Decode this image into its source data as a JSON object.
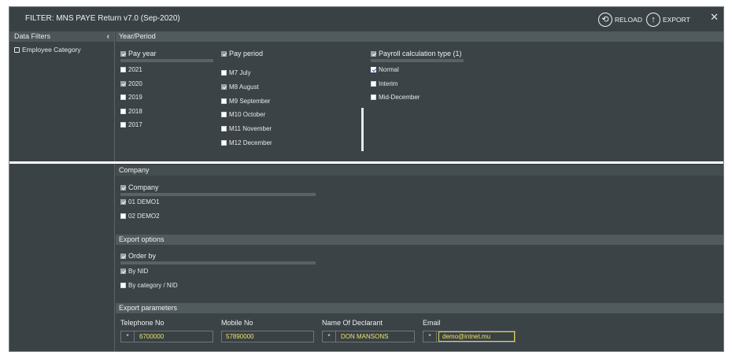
{
  "window": {
    "title": "FILTER: MNS PAYE Return v7.0 (Sep-2020)",
    "reload_label": "RELOAD",
    "export_label": "EXPORT",
    "close_symbol": "✕"
  },
  "left_panel": {
    "header": "Data Filters",
    "collapse_symbol": "‹",
    "items": [
      {
        "label": "Employee Category"
      }
    ]
  },
  "year_period": {
    "section_title": "Year/Period",
    "pay_year": {
      "title": "Pay year",
      "options": [
        {
          "label": "2021",
          "checked": false
        },
        {
          "label": "2020",
          "checked": true
        },
        {
          "label": "2019",
          "checked": false
        },
        {
          "label": "2018",
          "checked": false
        },
        {
          "label": "2017",
          "checked": false
        }
      ]
    },
    "pay_period": {
      "title": "Pay period",
      "options": [
        {
          "label": "M7 July",
          "checked": false
        },
        {
          "label": "M8 August",
          "checked": true
        },
        {
          "label": "M9 September",
          "checked": false
        },
        {
          "label": "M10 October",
          "checked": false
        },
        {
          "label": "M11 November",
          "checked": false
        },
        {
          "label": "M12 December",
          "checked": false
        }
      ]
    },
    "calc_type": {
      "title": "Payroll calculation type (1)",
      "options": [
        {
          "label": "Normal",
          "checked": true
        },
        {
          "label": "Interim",
          "checked": false
        },
        {
          "label": "Mid-December",
          "checked": false
        }
      ]
    }
  },
  "company": {
    "section_title": "Company",
    "group_title": "Company",
    "options": [
      {
        "label": "01 DEMO1",
        "checked": true
      },
      {
        "label": "02 DEMO2",
        "checked": false
      }
    ]
  },
  "export_options": {
    "section_title": "Export options",
    "group_title": "Order by",
    "options": [
      {
        "label": "By NID",
        "checked": true
      },
      {
        "label": "By category / NID",
        "checked": false
      }
    ]
  },
  "export_parameters": {
    "section_title": "Export parameters",
    "fields": [
      {
        "label": "Telephone No",
        "value": "6700000",
        "required_mark": "*"
      },
      {
        "label": "Mobile No",
        "value": "57890000",
        "required_mark": ""
      },
      {
        "label": "Name Of Declarant",
        "value": "DON MANSONS",
        "required_mark": "*"
      },
      {
        "label": "Email",
        "value": "demo@intnet.mu",
        "required_mark": "*"
      }
    ]
  },
  "colors": {
    "panel_bg": "#3c4346",
    "section_header": "#515a5d",
    "value_text": "#e9e36b",
    "checkbox_blue": "#1a5fd0"
  }
}
